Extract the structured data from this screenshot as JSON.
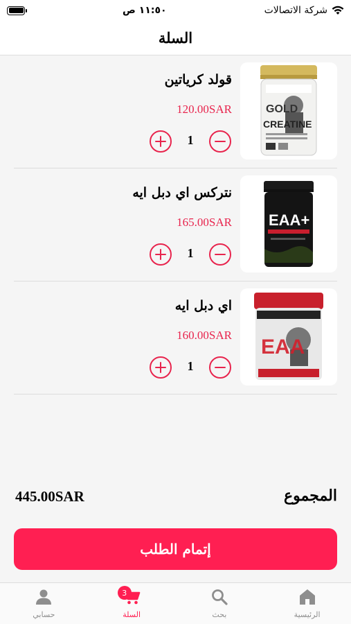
{
  "status_bar": {
    "carrier": "شركة الاتصالات",
    "time": "١١:٥٠ ص"
  },
  "header": {
    "title": "السلة"
  },
  "cart": {
    "items": [
      {
        "name": "قولد كرياتين",
        "price": "120.00SAR",
        "quantity": "1",
        "image": "gold-creatine-image"
      },
      {
        "name": "نتركس اي دبل ايه",
        "price": "165.00SAR",
        "quantity": "1",
        "image": "eaa-plus-image"
      },
      {
        "name": "اي دبل ايه",
        "price": "160.00SAR",
        "quantity": "1",
        "image": "eaa-enhanced-image"
      }
    ]
  },
  "summary": {
    "total_label": "المجموع",
    "total_value": "445.00SAR",
    "checkout_label": "إتمام الطلب"
  },
  "tab_bar": {
    "tabs": [
      {
        "label": "حسابي",
        "icon": "person-icon"
      },
      {
        "label": "السلة",
        "icon": "cart-icon",
        "badge": "3",
        "active": true
      },
      {
        "label": "بحث",
        "icon": "search-icon"
      },
      {
        "label": "الرئيسية",
        "icon": "home-icon"
      }
    ]
  },
  "colors": {
    "accent": "#ff1f52",
    "price": "#e8244d",
    "inactive": "#8e8e8e"
  }
}
